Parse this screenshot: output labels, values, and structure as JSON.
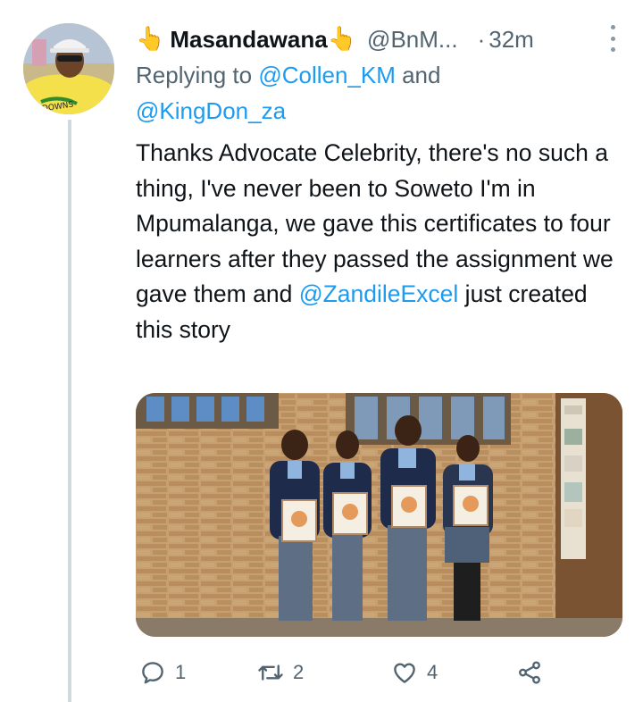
{
  "tweet": {
    "author": {
      "display_name": "Masandawana",
      "name_emoji_left": "👆",
      "name_emoji_right": "👆",
      "handle": "@BnM...",
      "avatar_icon": "avatar-photo"
    },
    "separator": "·",
    "time": "32m",
    "replying": {
      "prefix": "Replying to ",
      "mention1": "@Collen_KM",
      "conj": " and",
      "mention2": "@KingDon_za"
    },
    "text": {
      "part1": "Thanks Advocate Celebrity, there's no such a thing, I've never been to Soweto I'm in Mpumalanga, we gave this certificates to four learners after they passed the assignment we gave them and ",
      "mention": "@ZandileExcel",
      "part2": " just created this story"
    },
    "media": {
      "kind": "photo",
      "subject": "four learners holding certificates"
    },
    "actions": {
      "reply_count": "1",
      "retweet_count": "2",
      "like_count": "4"
    },
    "colors": {
      "link": "#1d9bf0",
      "secondary_text": "#536471",
      "thread_line": "#cfd9de",
      "emoji_yellow": "#f4b400"
    }
  }
}
